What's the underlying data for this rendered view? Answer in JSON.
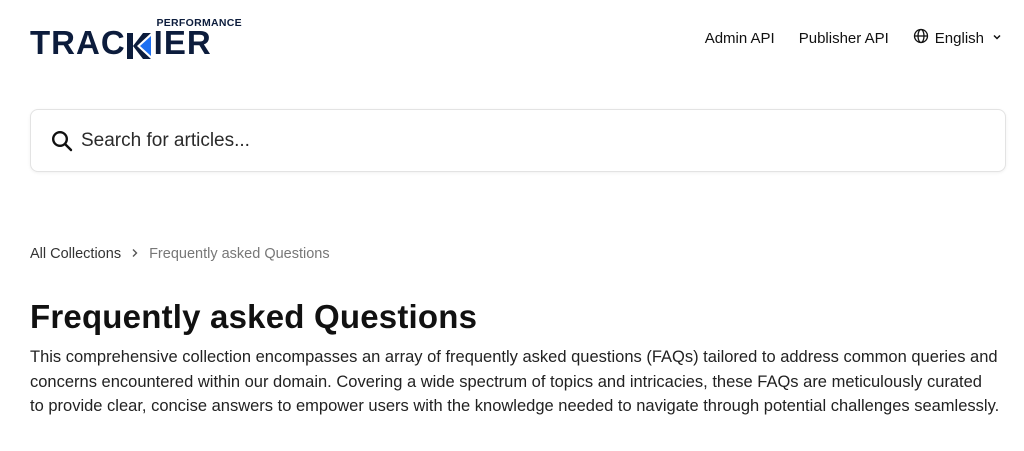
{
  "header": {
    "logo": {
      "top_text": "PERFORMANCE",
      "main_text_left": "TRAC",
      "main_text_right": "IER",
      "accent_color": "#1d6ff2",
      "brand_color": "#0c1c3c"
    },
    "nav": {
      "admin_api": "Admin API",
      "publisher_api": "Publisher API",
      "language": "English"
    }
  },
  "search": {
    "placeholder": "Search for articles..."
  },
  "breadcrumb": {
    "root": "All Collections",
    "current": "Frequently asked Questions"
  },
  "collection": {
    "title": "Frequently asked Questions",
    "description": "This comprehensive collection encompasses an array of frequently asked questions (FAQs) tailored to address common queries and concerns encountered within our domain. Covering a wide spectrum of topics and intricacies, these FAQs are meticulously curated to provide clear, concise answers to empower users with the knowledge needed to navigate through potential challenges seamlessly."
  }
}
